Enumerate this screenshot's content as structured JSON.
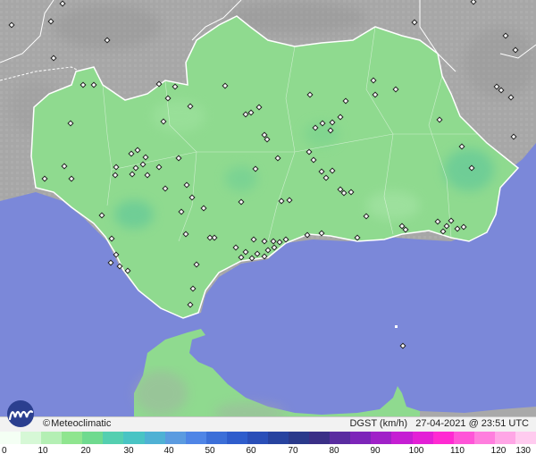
{
  "brand": {
    "symbol": "©",
    "name": "Meteoclimatic"
  },
  "status": {
    "variable": "DGST",
    "unit": "(km/h)",
    "timestamp": "27-04-2021 @ 23:51 UTC"
  },
  "scale": {
    "ticks": [
      "0",
      "10",
      "20",
      "30",
      "40",
      "50",
      "60",
      "70",
      "80",
      "90",
      "100",
      "110",
      "120",
      "130"
    ],
    "colors": [
      "#f4fff4",
      "#d6f8d6",
      "#b4efb4",
      "#8fe58f",
      "#6fda8f",
      "#54cfb0",
      "#49c4c4",
      "#4fb1d4",
      "#5b9be0",
      "#4f85e6",
      "#3c6fd8",
      "#2f5dcc",
      "#2a4fb8",
      "#27439f",
      "#2a3a8b",
      "#3a2f86",
      "#5a2ca0",
      "#7d25b9",
      "#a021c8",
      "#c51ed3",
      "#e320d6",
      "#ff2ad2",
      "#ff55d8",
      "#ff7ede",
      "#ffa6e6",
      "#ffcbef"
    ]
  },
  "colors": {
    "sea": "#7b88d9",
    "land_outside": "#a9a9a9",
    "land_region": "#8fda8f",
    "border": "#ffffff"
  },
  "map": {
    "layers": [
      "sea",
      "surrounding-land",
      "andalusia-region",
      "north-africa",
      "station-markers"
    ]
  }
}
